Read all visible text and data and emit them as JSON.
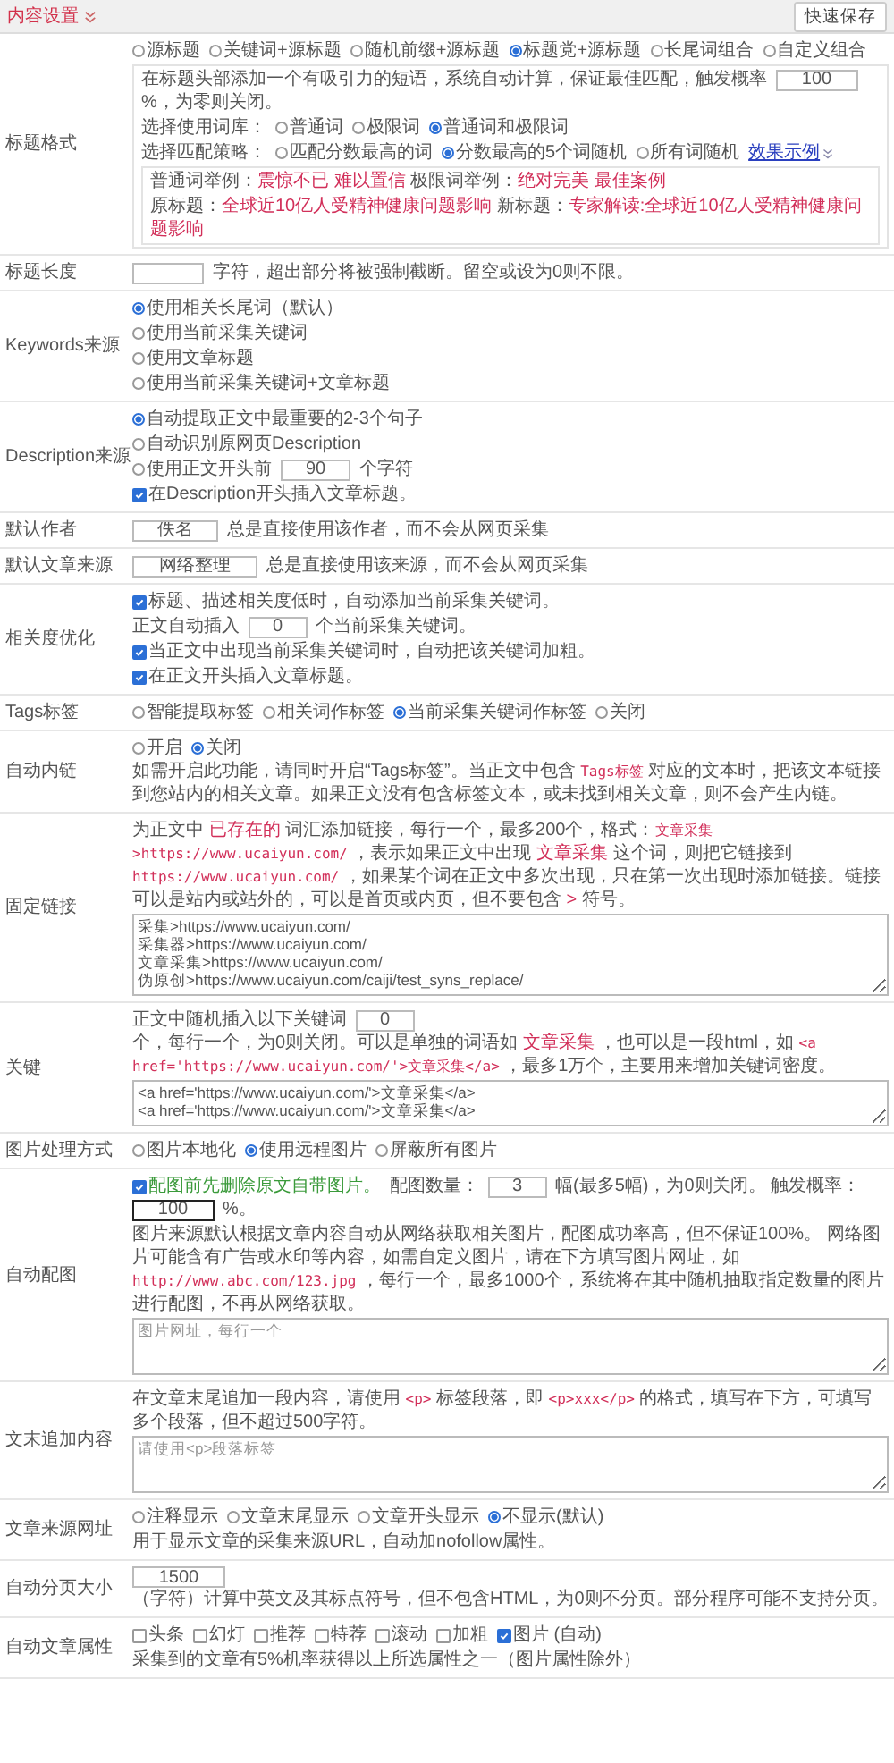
{
  "header": {
    "title": "内容设置",
    "button": "快速保存"
  },
  "sections": [
    {
      "label": "标题格式",
      "lines": [
        {
          "parts": [
            {
              "kind": "radio",
              "label": "源标题",
              "selected": false
            },
            {
              "kind": "radio",
              "label": "关键词+源标题",
              "selected": false
            },
            {
              "kind": "radio",
              "label": "随机前缀+源标题",
              "selected": false
            },
            {
              "kind": "radio",
              "label": "标题党+源标题",
              "selected": true
            },
            {
              "kind": "radio",
              "label": "长尾词组合",
              "selected": false
            },
            {
              "kind": "radio",
              "label": "自定义组合",
              "selected": false
            }
          ]
        },
        {
          "kind": "panel",
          "lines": [
            {
              "parts": [
                {
                  "kind": "text",
                  "text": "在标题头部添加一个有吸引力的短语，系统自动计算，保证最佳匹配，触发概率"
                },
                {
                  "kind": "input",
                  "value": "100"
                },
                {
                  "kind": "text",
                  "text": "%，为零则关闭。"
                }
              ]
            },
            {
              "parts": [
                {
                  "kind": "text",
                  "text": "选择使用词库："
                },
                {
                  "kind": "radio",
                  "label": "普通词",
                  "selected": false
                },
                {
                  "kind": "radio",
                  "label": "极限词",
                  "selected": false
                },
                {
                  "kind": "radio",
                  "label": "普通词和极限词",
                  "selected": true
                }
              ]
            },
            {
              "parts": [
                {
                  "kind": "text",
                  "text": "选择匹配策略："
                },
                {
                  "kind": "radio",
                  "label": "匹配分数最高的词",
                  "selected": false
                },
                {
                  "kind": "radio",
                  "label": "分数最高的5个词随机",
                  "selected": true
                },
                {
                  "kind": "radio",
                  "label": "所有词随机",
                  "selected": false
                },
                {
                  "kind": "link",
                  "text": "效果示例"
                }
              ]
            },
            {
              "kind": "panel",
              "lines": [
                {
                  "parts": [
                    {
                      "kind": "text",
                      "text": "普通词举例："
                    },
                    {
                      "kind": "hl",
                      "text": "震惊不已 难以置信"
                    },
                    {
                      "kind": "text",
                      "text": " 极限词举例："
                    },
                    {
                      "kind": "hl",
                      "text": "绝对完美 最佳案例"
                    }
                  ]
                },
                {
                  "parts": [
                    {
                      "kind": "text",
                      "text": "原标题："
                    },
                    {
                      "kind": "hl",
                      "text": "全球近10亿人受精神健康问题影响"
                    },
                    {
                      "kind": "text",
                      "text": " 新标题："
                    },
                    {
                      "kind": "hl",
                      "text": "专家解读:全球近10亿人受精神健康问题影响"
                    }
                  ]
                }
              ]
            }
          ]
        }
      ]
    },
    {
      "label": "标题长度",
      "lines": [
        {
          "parts": [
            {
              "kind": "input"
            },
            {
              "kind": "text",
              "text": "字符，超出部分将被强制截断。留空或设为0则不限。"
            }
          ]
        }
      ]
    },
    {
      "label": "Keywords来源",
      "lines": [
        {
          "parts": [
            {
              "kind": "radio",
              "label": "使用相关长尾词（默认）",
              "selected": true
            }
          ]
        },
        {
          "parts": [
            {
              "kind": "radio",
              "label": "使用当前采集关键词",
              "selected": false
            }
          ]
        },
        {
          "parts": [
            {
              "kind": "radio",
              "label": "使用文章标题",
              "selected": false
            }
          ]
        },
        {
          "parts": [
            {
              "kind": "radio",
              "label": "使用当前采集关键词+文章标题",
              "selected": false
            }
          ]
        }
      ]
    },
    {
      "label": "Description来源",
      "lines": [
        {
          "parts": [
            {
              "kind": "radio",
              "label": "自动提取正文中最重要的2-3个句子",
              "selected": true
            }
          ]
        },
        {
          "parts": [
            {
              "kind": "radio",
              "label": "自动识别原网页Description",
              "selected": false
            }
          ]
        },
        {
          "parts": [
            {
              "kind": "radio",
              "label": "使用正文开头前",
              "selected": false
            },
            {
              "kind": "input",
              "value": "90"
            },
            {
              "kind": "text",
              "text": "个字符"
            }
          ]
        },
        {
          "parts": [
            {
              "kind": "checkbox",
              "label": "在Description开头插入文章标题。",
              "checked": true
            }
          ]
        }
      ]
    },
    {
      "label": "默认作者",
      "lines": [
        {
          "parts": [
            {
              "kind": "input",
              "value": "佚名"
            },
            {
              "kind": "text",
              "text": "总是直接使用该作者，而不会从网页采集"
            }
          ]
        }
      ]
    },
    {
      "label": "默认文章来源",
      "lines": [
        {
          "parts": [
            {
              "kind": "input",
              "value": "网络整理"
            },
            {
              "kind": "text",
              "text": "总是直接使用该来源，而不会从网页采集"
            }
          ]
        }
      ]
    },
    {
      "label": "相关度优化",
      "lines": [
        {
          "parts": [
            {
              "kind": "checkbox",
              "label": "标题、描述相关度低时，自动添加当前采集关键词。",
              "checked": true
            }
          ]
        },
        {
          "parts": [
            {
              "kind": "text",
              "text": "正文自动插入"
            },
            {
              "kind": "input",
              "value": "0"
            },
            {
              "kind": "text",
              "text": "个当前采集关键词。"
            }
          ]
        },
        {
          "parts": [
            {
              "kind": "checkbox",
              "label": "当正文中出现当前采集关键词时，自动把该关键词加粗。",
              "checked": true
            }
          ]
        },
        {
          "parts": [
            {
              "kind": "checkbox",
              "label": "在正文开头插入文章标题。",
              "checked": true
            }
          ]
        }
      ]
    },
    {
      "label": "Tags标签",
      "lines": [
        {
          "parts": [
            {
              "kind": "radio",
              "label": "智能提取标签",
              "selected": false
            },
            {
              "kind": "radio",
              "label": "相关词作标签",
              "selected": false
            },
            {
              "kind": "radio",
              "label": "当前采集关键词作标签",
              "selected": true
            },
            {
              "kind": "radio",
              "label": "关闭",
              "selected": false
            }
          ]
        }
      ]
    },
    {
      "label": "自动内链",
      "lines": [
        {
          "parts": [
            {
              "kind": "radio",
              "label": "开启",
              "selected": false
            },
            {
              "kind": "radio",
              "label": "关闭",
              "selected": true
            },
            {
              "kind": "text",
              "text": "如需开启此功能，请同时开启“Tags标签”。当正文中包含 "
            },
            {
              "kind": "code",
              "text": "Tags标签"
            },
            {
              "kind": "text",
              "text": " 对应的文本时，把该文本链接到您站内的相关文章。如果正文没有包含标签文本，或未找到相关文章，则不会产生内链。"
            }
          ]
        }
      ]
    },
    {
      "label": "固定链接",
      "lines": [
        {
          "parts": [
            {
              "kind": "text",
              "text": "为正文中 "
            },
            {
              "kind": "hl",
              "text": "已存在的"
            },
            {
              "kind": "text",
              "text": " 词汇添加链接，每行一个，最多200个，格式："
            },
            {
              "kind": "code",
              "text": "文章采集>https://www.ucaiyun.com/"
            },
            {
              "kind": "text",
              "text": " ，表示如果正文中出现 "
            },
            {
              "kind": "hl",
              "text": "文章采集"
            },
            {
              "kind": "text",
              "text": " 这个词，则把它链接到 "
            },
            {
              "kind": "code",
              "text": "https://www.ucaiyun.com/"
            },
            {
              "kind": "text",
              "text": " ，如果某个词在正文中多次出现，只在第一次出现时添加链接。链接可以是站内或站外的，可以是首页或内页，但不要包含 "
            },
            {
              "kind": "hl",
              "text": ">"
            },
            {
              "kind": "text",
              "text": " 符号。"
            }
          ]
        },
        {
          "kind": "textarea",
          "value": "采集>https://www.ucaiyun.com/\n采集器>https://www.ucaiyun.com/\n文章采集>https://www.ucaiyun.com/\n伪原创>https://www.ucaiyun.com/caiji/test_syns_replace/"
        }
      ]
    },
    {
      "label": "关键",
      "lines": [
        {
          "parts": [
            {
              "kind": "text",
              "text": "正文中随机插入以下关键词"
            },
            {
              "kind": "input",
              "value": "0"
            },
            {
              "kind": "text",
              "text": "个，每行一个，为0则关闭。可以是单独的词语如 "
            },
            {
              "kind": "hl",
              "text": "文章采集"
            },
            {
              "kind": "text",
              "text": " ，也可以是一段html，如 "
            },
            {
              "kind": "code",
              "text": "<a href='https://www.ucaiyun.com/'>文章采集</a>"
            },
            {
              "kind": "text",
              "text": " ，最多1万个，主要用来增加关键词密度。"
            }
          ]
        },
        {
          "kind": "textarea",
          "value": "<a href='https://www.ucaiyun.com/'>文章采集</a>\n<a href='https://www.ucaiyun.com/'>文章采集</a>"
        }
      ]
    },
    {
      "label": "图片处理方式",
      "lines": [
        {
          "parts": [
            {
              "kind": "radio",
              "label": "图片本地化",
              "selected": false
            },
            {
              "kind": "radio",
              "label": "使用远程图片",
              "selected": true
            },
            {
              "kind": "radio",
              "label": "屏蔽所有图片",
              "selected": false
            }
          ]
        }
      ]
    },
    {
      "label": "自动配图",
      "lines": [
        {
          "parts": [
            {
              "kind": "checkbox",
              "label": "配图前先删除原文自带图片。",
              "checked": true,
              "highlighted": true
            },
            {
              "kind": "text",
              "text": "配图数量："
            },
            {
              "kind": "input",
              "value": "3"
            },
            {
              "kind": "text",
              "text": "幅(最多5幅)，为0则关闭。 触发概率："
            },
            {
              "kind": "input",
              "value": "100",
              "focused": true
            },
            {
              "kind": "text",
              "text": "%。"
            }
          ]
        },
        {
          "parts": [
            {
              "kind": "text",
              "text": "图片来源默认根据文章内容自动从网络获取相关图片，配图成功率高，但不保证100%。 网络图片可能含有广告或水印等内容，如需自定义图片，请在下方填写图片网址，如 "
            },
            {
              "kind": "code",
              "text": "http://www.abc.com/123.jpg"
            },
            {
              "kind": "text",
              "text": " ，每行一个，最多1000个，系统将在其中随机抽取指定数量的图片进行配图，不再从网络获取。"
            }
          ]
        },
        {
          "kind": "textarea",
          "placeholder": "图片网址，每行一个"
        }
      ]
    },
    {
      "label": "文末追加内容",
      "lines": [
        {
          "parts": [
            {
              "kind": "text",
              "text": "在文章末尾追加一段内容，请使用 "
            },
            {
              "kind": "code",
              "text": "<p>"
            },
            {
              "kind": "text",
              "text": " 标签段落，即 "
            },
            {
              "kind": "code",
              "text": "<p>xxx</p>"
            },
            {
              "kind": "text",
              "text": " 的格式，填写在下方，可填写多个段落，但不超过500字符。"
            }
          ]
        },
        {
          "kind": "textarea",
          "placeholder": "请使用<p>段落标签"
        }
      ]
    },
    {
      "label": "文章来源网址",
      "lines": [
        {
          "parts": [
            {
              "kind": "radio",
              "label": "注释显示",
              "selected": false
            },
            {
              "kind": "radio",
              "label": "文章末尾显示",
              "selected": false
            },
            {
              "kind": "radio",
              "label": "文章开头显示",
              "selected": false
            },
            {
              "kind": "radio",
              "label": "不显示(默认)",
              "selected": true
            }
          ]
        },
        {
          "parts": [
            {
              "kind": "text",
              "text": "用于显示文章的采集来源URL，自动加nofollow属性。"
            }
          ]
        }
      ]
    },
    {
      "label": "自动分页大小",
      "lines": [
        {
          "parts": [
            {
              "kind": "input",
              "value": "1500"
            },
            {
              "kind": "text",
              "text": "（字符）计算中英文及其标点符号，但不包含HTML，为0则不分页。部分程序可能不支持分页。"
            }
          ]
        }
      ]
    },
    {
      "label": "自动文章属性",
      "lines": [
        {
          "parts": [
            {
              "kind": "checkbox",
              "label": "头条",
              "checked": false
            },
            {
              "kind": "checkbox",
              "label": "幻灯",
              "checked": false
            },
            {
              "kind": "checkbox",
              "label": "推荐",
              "checked": false
            },
            {
              "kind": "checkbox",
              "label": "特荐",
              "checked": false
            },
            {
              "kind": "checkbox",
              "label": "滚动",
              "checked": false
            },
            {
              "kind": "checkbox",
              "label": "加粗",
              "checked": false
            },
            {
              "kind": "checkbox",
              "label": "图片 (自动)",
              "checked": true
            }
          ]
        },
        {
          "parts": [
            {
              "kind": "text",
              "text": "采集到的文章有5%机率获得以上所选属性之一（图片属性除外）"
            }
          ]
        }
      ]
    }
  ]
}
